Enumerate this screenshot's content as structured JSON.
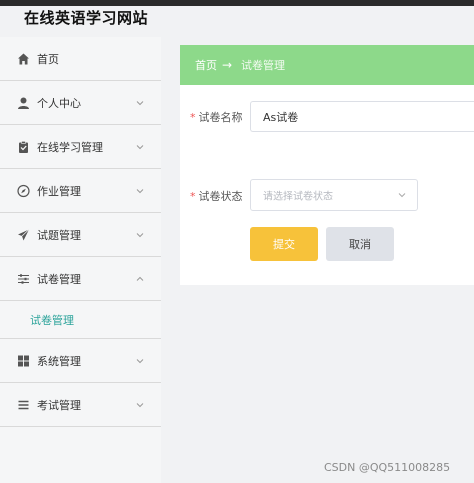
{
  "site": {
    "title": "在线英语学习网站"
  },
  "sidebar": {
    "items": [
      {
        "label": "首页",
        "icon": "home-icon"
      },
      {
        "label": "个人中心",
        "icon": "user-icon"
      },
      {
        "label": "在线学习管理",
        "icon": "clipboard-icon"
      },
      {
        "label": "作业管理",
        "icon": "compass-icon"
      },
      {
        "label": "试题管理",
        "icon": "send-icon"
      },
      {
        "label": "试卷管理",
        "icon": "sliders-icon"
      },
      {
        "label": "系统管理",
        "icon": "grid-icon"
      },
      {
        "label": "考试管理",
        "icon": "list-icon"
      }
    ],
    "sub_item": {
      "label": "试卷管理"
    }
  },
  "breadcrumb": {
    "home": "首页",
    "separator": "→",
    "current": "试卷管理"
  },
  "form": {
    "name_label": "试卷名称",
    "name_value": "As试卷",
    "status_label": "试卷状态",
    "status_placeholder": "请选择试卷状态",
    "required_mark": "*"
  },
  "buttons": {
    "submit": "提交",
    "cancel": "取消"
  },
  "watermark": "CSDN @QQ511008285",
  "colors": {
    "breadcrumb_bg": "#8dd98a",
    "submit_bg": "#f7c23a",
    "cancel_bg": "#dfe2e8",
    "active_submenu": "#2aa39a"
  }
}
